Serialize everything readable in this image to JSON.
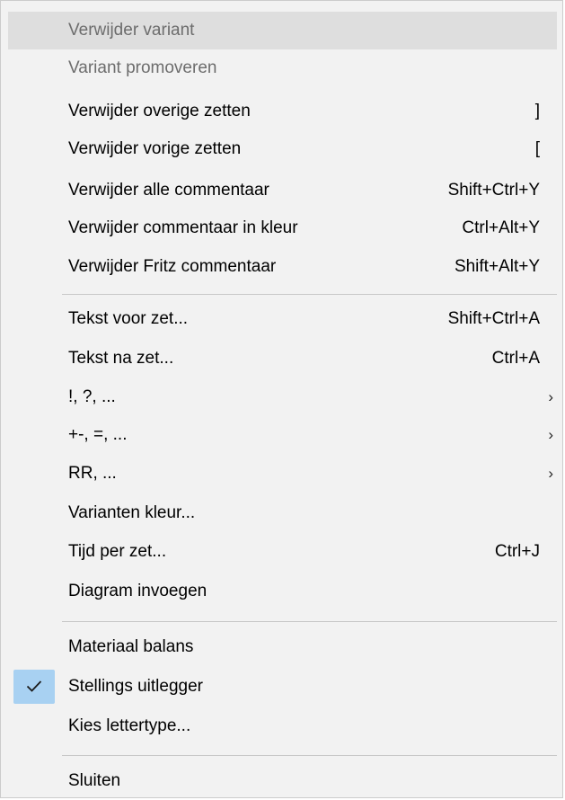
{
  "menu": {
    "items": [
      {
        "label": "Verwijder variant",
        "shortcut": "",
        "disabled": true,
        "highlighted": true
      },
      {
        "label": "Variant promoveren",
        "shortcut": "",
        "disabled": true
      },
      {
        "label": "Verwijder overige zetten",
        "shortcut": "]"
      },
      {
        "label": "Verwijder vorige zetten",
        "shortcut": "["
      },
      {
        "label": "Verwijder alle commentaar",
        "shortcut": "Shift+Ctrl+Y"
      },
      {
        "label": "Verwijder commentaar in kleur",
        "shortcut": "Ctrl+Alt+Y"
      },
      {
        "label": "Verwijder Fritz commentaar",
        "shortcut": "Shift+Alt+Y"
      },
      {
        "label": "Tekst voor zet...",
        "shortcut": "Shift+Ctrl+A"
      },
      {
        "label": "Tekst na zet...",
        "shortcut": "Ctrl+A"
      },
      {
        "label": "!, ?, ...",
        "submenu": true
      },
      {
        "label": "+-, =, ...",
        "submenu": true
      },
      {
        "label": "RR, ...",
        "submenu": true
      },
      {
        "label": "Varianten kleur..."
      },
      {
        "label": "Tijd per zet...",
        "shortcut": "Ctrl+J"
      },
      {
        "label": "Diagram invoegen"
      },
      {
        "label": "Materiaal balans"
      },
      {
        "label": "Stellings uitlegger",
        "checked": true
      },
      {
        "label": "Kies lettertype..."
      },
      {
        "label": "Sluiten"
      }
    ],
    "submenu_arrow": "›",
    "checkmark_icon": "checkmark-icon",
    "colors": {
      "background": "#f2f2f2",
      "highlight": "#dedede",
      "check_bg": "#a8d1f2",
      "disabled_text": "#6d6d6d"
    }
  }
}
